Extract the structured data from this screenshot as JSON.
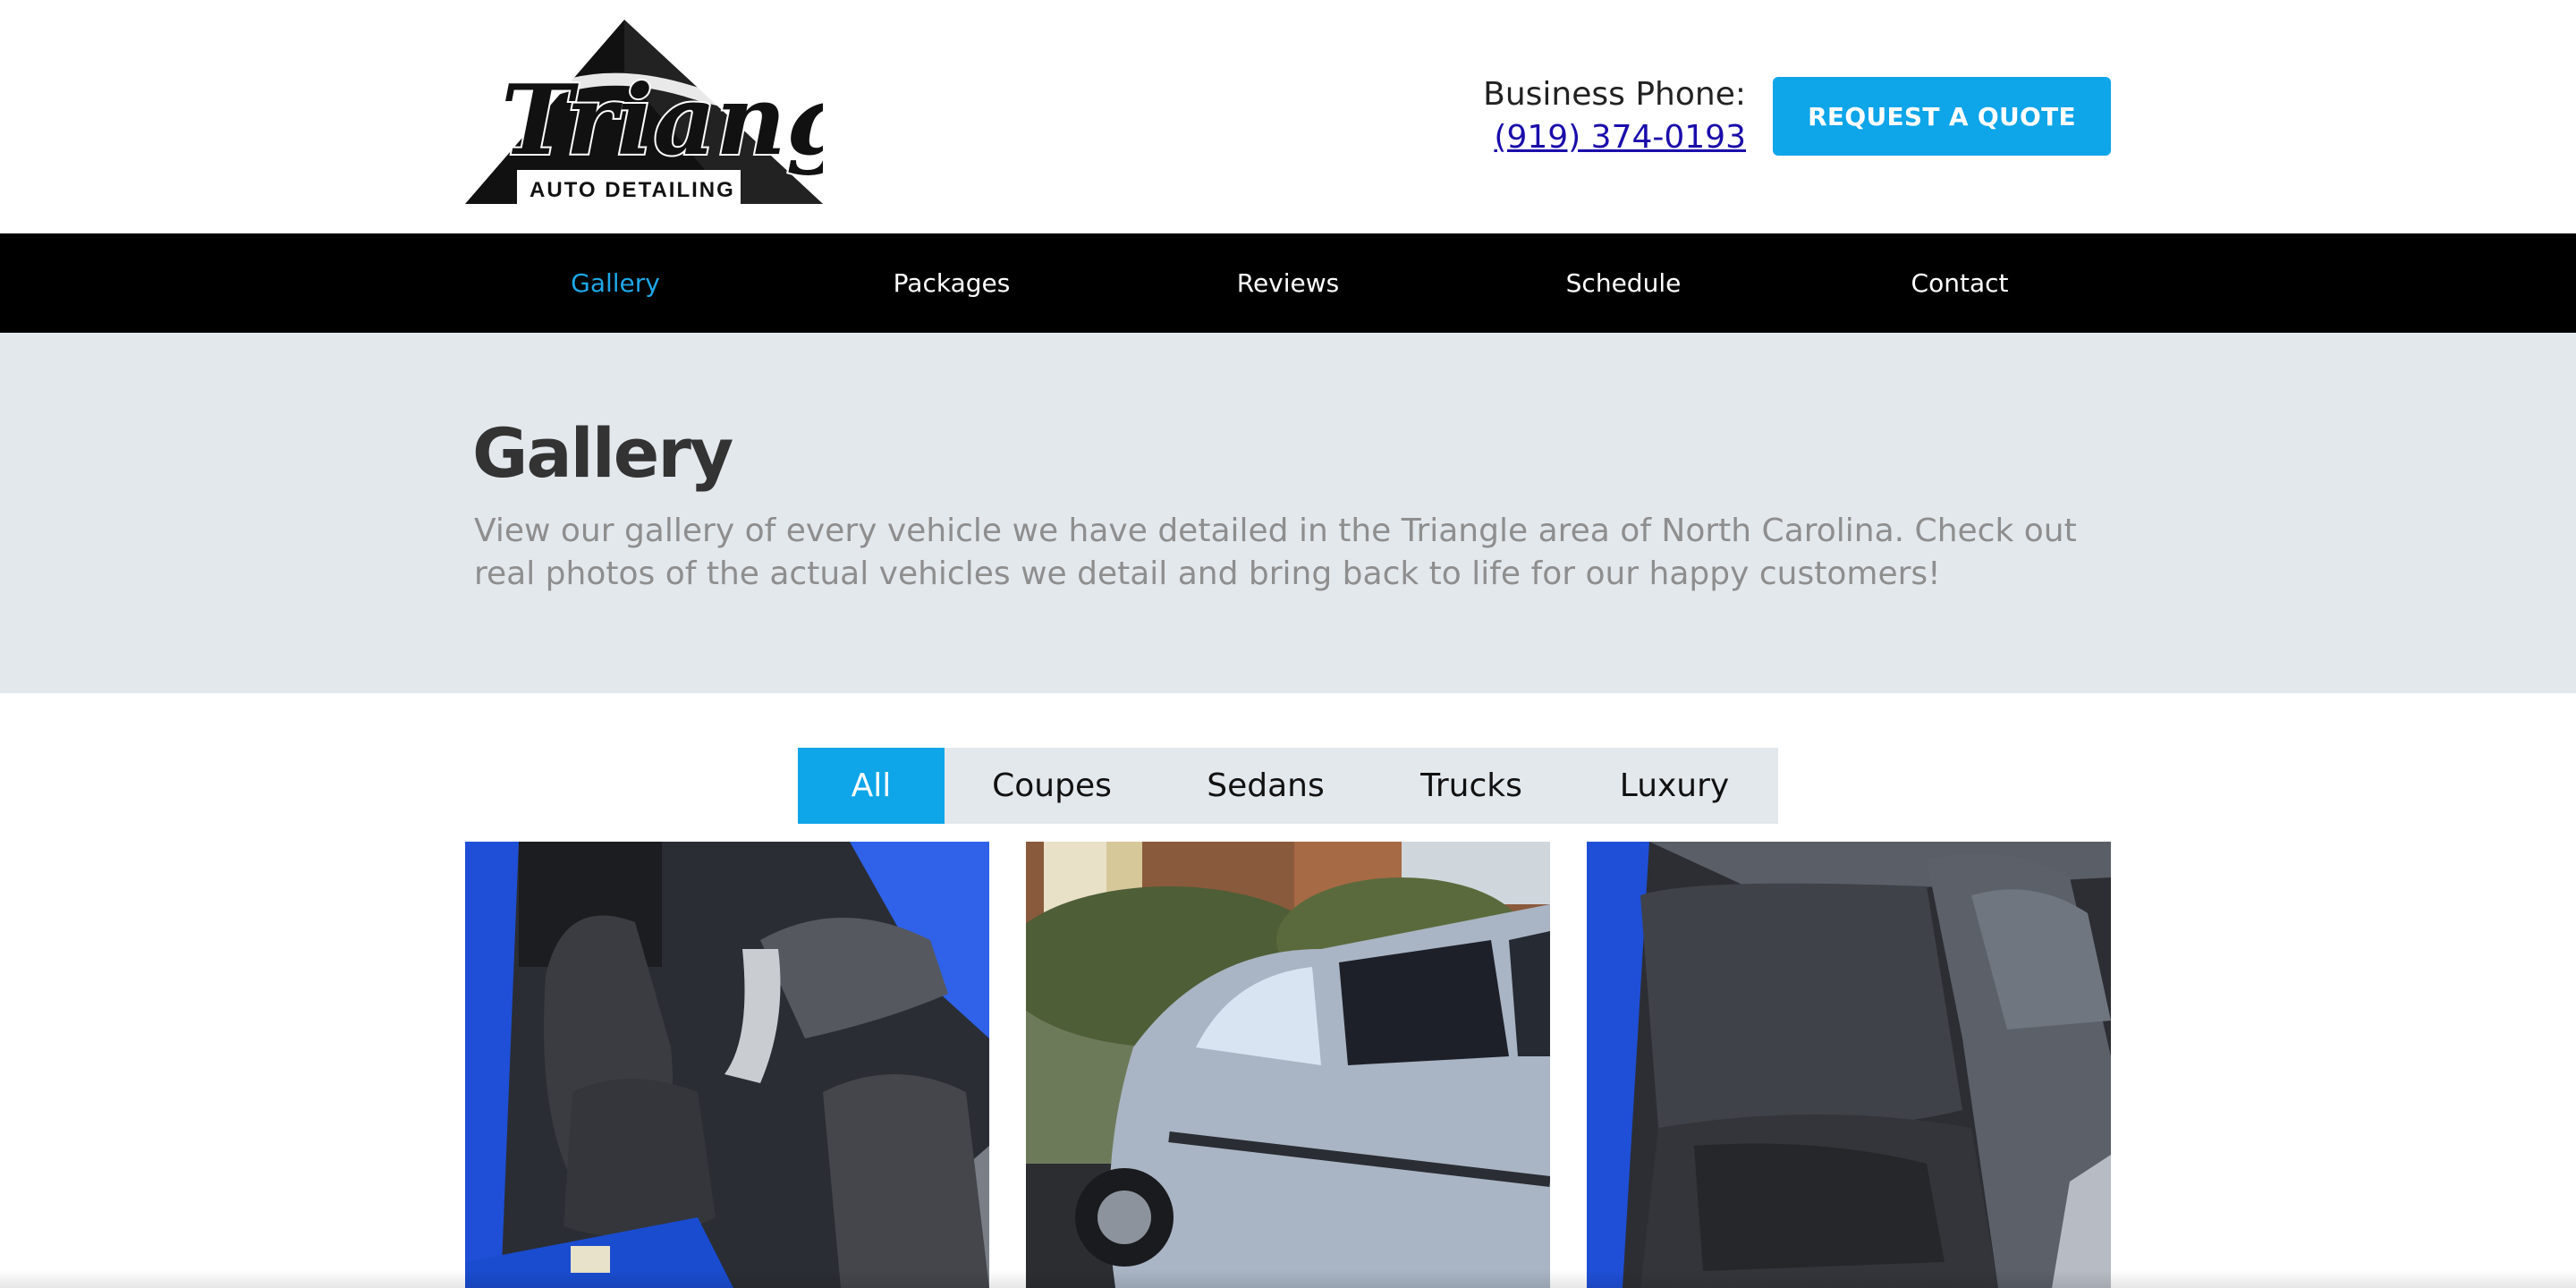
{
  "header": {
    "logo": {
      "script_text": "Triangle",
      "sub_text": "AUTO DETAILING"
    },
    "phone_label": "Business Phone:",
    "phone_number": "(919) 374-0193",
    "quote_button": "REQUEST A QUOTE"
  },
  "nav": {
    "items": [
      {
        "label": "Gallery",
        "active": true
      },
      {
        "label": "Packages"
      },
      {
        "label": "Reviews"
      },
      {
        "label": "Schedule"
      },
      {
        "label": "Contact"
      }
    ]
  },
  "hero": {
    "title": "Gallery",
    "description": "View our gallery of every vehicle we have detailed in the Triangle area of North Carolina. Check out real photos of the actual vehicles we detail and bring back to life for our happy customers!"
  },
  "filters": {
    "tabs": [
      {
        "label": "All",
        "active": true
      },
      {
        "label": "Coupes"
      },
      {
        "label": "Sedans"
      },
      {
        "label": "Trucks"
      },
      {
        "label": "Luxury"
      }
    ]
  },
  "colors": {
    "accent": "#0ea5e9",
    "nav_active": "#1ea7e8",
    "nav_background": "#000000",
    "hero_background": "#e3e8ed"
  }
}
